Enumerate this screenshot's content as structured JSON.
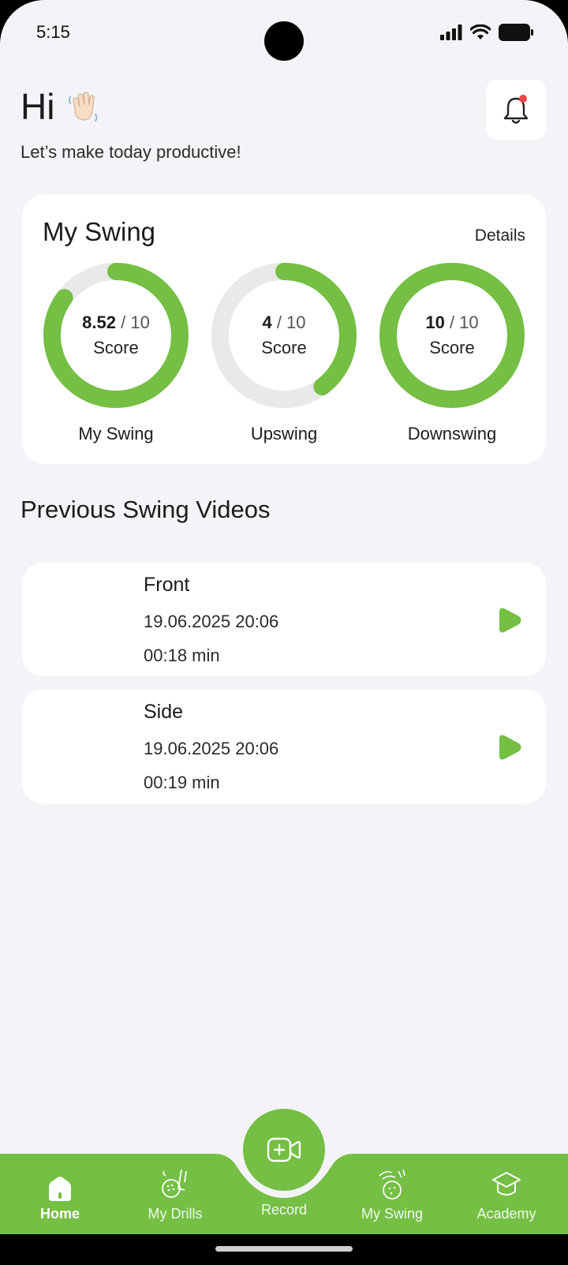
{
  "status_bar": {
    "time": "5:15"
  },
  "header": {
    "greeting": "Hi",
    "subtitle": "Let’s make today productive!",
    "notification_icon": "bell-icon",
    "has_notification": true
  },
  "swing_card": {
    "title": "My Swing",
    "details_label": "Details",
    "scores": [
      {
        "value": "8.52",
        "max": "10",
        "unit": "Score",
        "label": "My Swing",
        "fraction": 0.852
      },
      {
        "value": "4",
        "max": "10",
        "unit": "Score",
        "label": "Upswing",
        "fraction": 0.4
      },
      {
        "value": "10",
        "max": "10",
        "unit": "Score",
        "label": "Downswing",
        "fraction": 1.0
      }
    ]
  },
  "videos": {
    "section_title": "Previous Swing Videos",
    "items": [
      {
        "name": "Front",
        "date": "19.06.2025 20:06",
        "duration": "00:18 min"
      },
      {
        "name": "Side",
        "date": "19.06.2025 20:06",
        "duration": "00:19 min"
      }
    ]
  },
  "nav": {
    "items": [
      {
        "label": "Home",
        "icon": "home-icon",
        "active": true
      },
      {
        "label": "My Drills",
        "icon": "golf-drills-icon",
        "active": false
      },
      {
        "label": "Record",
        "icon": "video-add-icon",
        "active": false
      },
      {
        "label": "My Swing",
        "icon": "golf-swing-icon",
        "active": false
      },
      {
        "label": "Academy",
        "icon": "graduation-cap-icon",
        "active": false
      }
    ]
  },
  "colors": {
    "accent": "#74bf44",
    "track": "#e9e9e9",
    "background": "#f4f4f8",
    "notification_dot": "#e84545"
  }
}
